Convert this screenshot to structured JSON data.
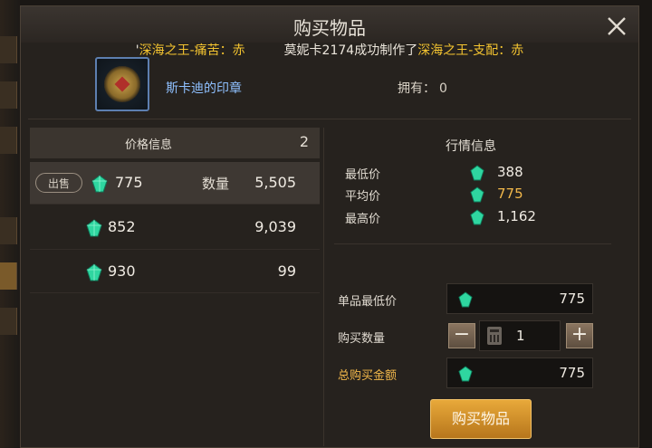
{
  "window": {
    "title": "购买物品",
    "close_icon": "close-icon"
  },
  "ticker": {
    "prefix": "'",
    "msg1_item": "深海之王-痛苦：赤",
    "msg2_user": "莫妮卡2174成功制作了",
    "msg2_item": "深海之王-支配：赤"
  },
  "item": {
    "name": "斯卡迪的印章",
    "owned_label": "拥有：",
    "owned_value": "0",
    "icon": "seal-icon"
  },
  "price_panel": {
    "header": "价格信息",
    "count": "2",
    "rows": [
      {
        "sell_label": "出售",
        "price": "775",
        "qty_label": "数量",
        "qty": "5,505",
        "selected": true
      },
      {
        "price": "852",
        "qty": "9,039"
      },
      {
        "price": "930",
        "qty": "99"
      }
    ]
  },
  "market_panel": {
    "header": "行情信息",
    "rows": [
      {
        "label": "最低价",
        "value": "388"
      },
      {
        "label": "平均价",
        "value": "775"
      },
      {
        "label": "最高价",
        "value": "1,162"
      }
    ]
  },
  "purchase": {
    "unit_min_label": "单品最低价",
    "unit_min_value": "775",
    "quantity_label": "购买数量",
    "quantity_value": "1",
    "minus": "−",
    "plus": "+",
    "total_label": "总购买金额",
    "total_value": "775",
    "buy_button": "购买物品"
  },
  "colors": {
    "gold": "#f2b84a",
    "ticker_gold": "#f4c430",
    "item_blue": "#8fc0ff",
    "gem": "#2fd6a0",
    "button": "#d08e28"
  }
}
